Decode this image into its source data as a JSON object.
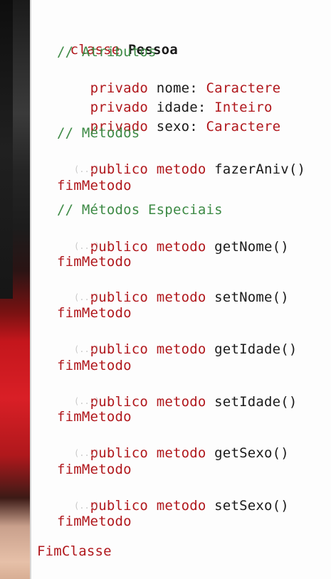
{
  "table": {
    "row1_symbol": "-",
    "row2_symbol": "+"
  },
  "code": {
    "class_keyword": "classe",
    "class_name": "Pessoa",
    "comment_attributes": "// Atributos",
    "attributes": [
      {
        "visibility": "privado",
        "name": "nome:",
        "type": "Caractere"
      },
      {
        "visibility": "privado",
        "name": "idade:",
        "type": "Inteiro"
      },
      {
        "visibility": "privado",
        "name": "sexo:",
        "type": "Caractere"
      }
    ],
    "comment_methods": "// Métodos",
    "comment_special_methods": "// Métodos Especiais",
    "method_visibility": "publico",
    "method_keyword": "metodo",
    "method_names": [
      "fazerAniv()",
      "getNome()",
      "setNome()",
      "getIdade()",
      "setIdade()",
      "getSexo()",
      "setSexo()"
    ],
    "ellipsis": "(...)",
    "end_method": "fimMetodo",
    "end_class": "FimClasse"
  },
  "colors": {
    "keyword": "#b0171c",
    "identifier": "#1a1a1a",
    "comment": "#3d8a45",
    "ellipsis": "#c8c8c8"
  }
}
